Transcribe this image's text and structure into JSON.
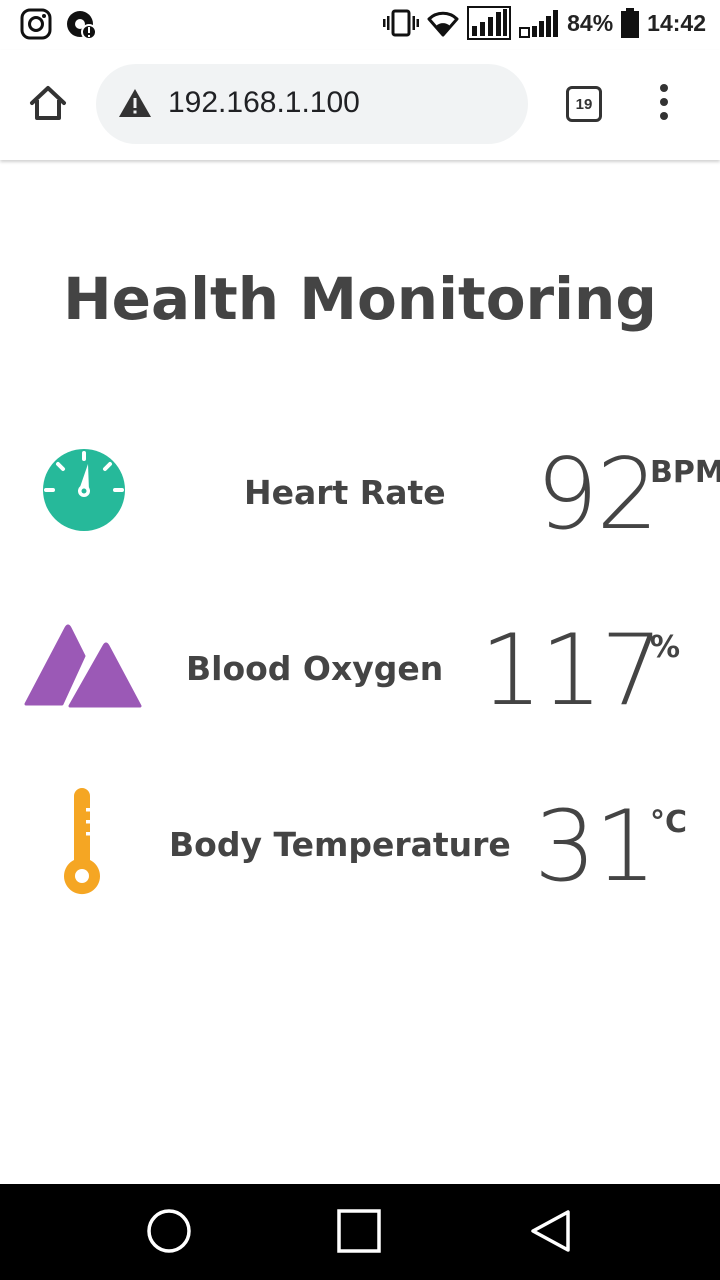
{
  "status_bar": {
    "battery_percent": "84%",
    "time": "14:42",
    "icons": [
      "instagram-icon",
      "notification-icon",
      "vibrate-icon",
      "wifi-icon",
      "signal-sim1-icon",
      "signal-sim2-icon",
      "battery-icon"
    ]
  },
  "browser": {
    "url": "192.168.1.100",
    "tab_count": "19",
    "security_icon": "warning-icon"
  },
  "page": {
    "title": "Health Monitoring",
    "readings": [
      {
        "label": "Heart Rate",
        "value": "92",
        "unit": "BPM",
        "icon": "gauge-icon",
        "color": "#26b99a"
      },
      {
        "label": "Blood Oxygen",
        "value": "117",
        "unit": "%",
        "icon": "mountains-icon",
        "color": "#9b59b6"
      },
      {
        "label": "Body Temperature",
        "value": "31",
        "unit": "°C",
        "icon": "thermometer-icon",
        "color": "#f5a623"
      }
    ]
  }
}
